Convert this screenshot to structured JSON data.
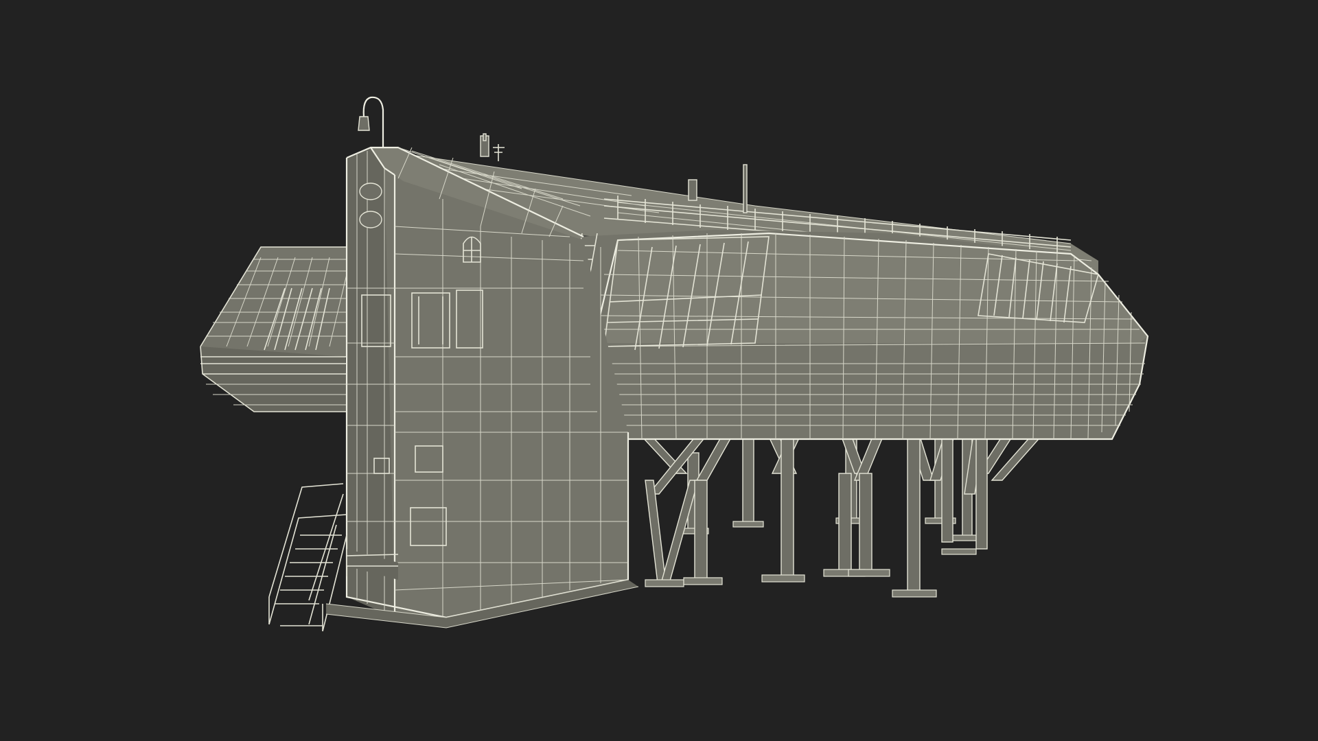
{
  "scene": {
    "subject": "station-wireframe-render",
    "background_color": "#222222",
    "model_fill_color": "#74746a",
    "wire_color": "#e4e4d6"
  },
  "icons": {
    "lamp": "lamp-icon",
    "antenna": "antenna-icon"
  }
}
